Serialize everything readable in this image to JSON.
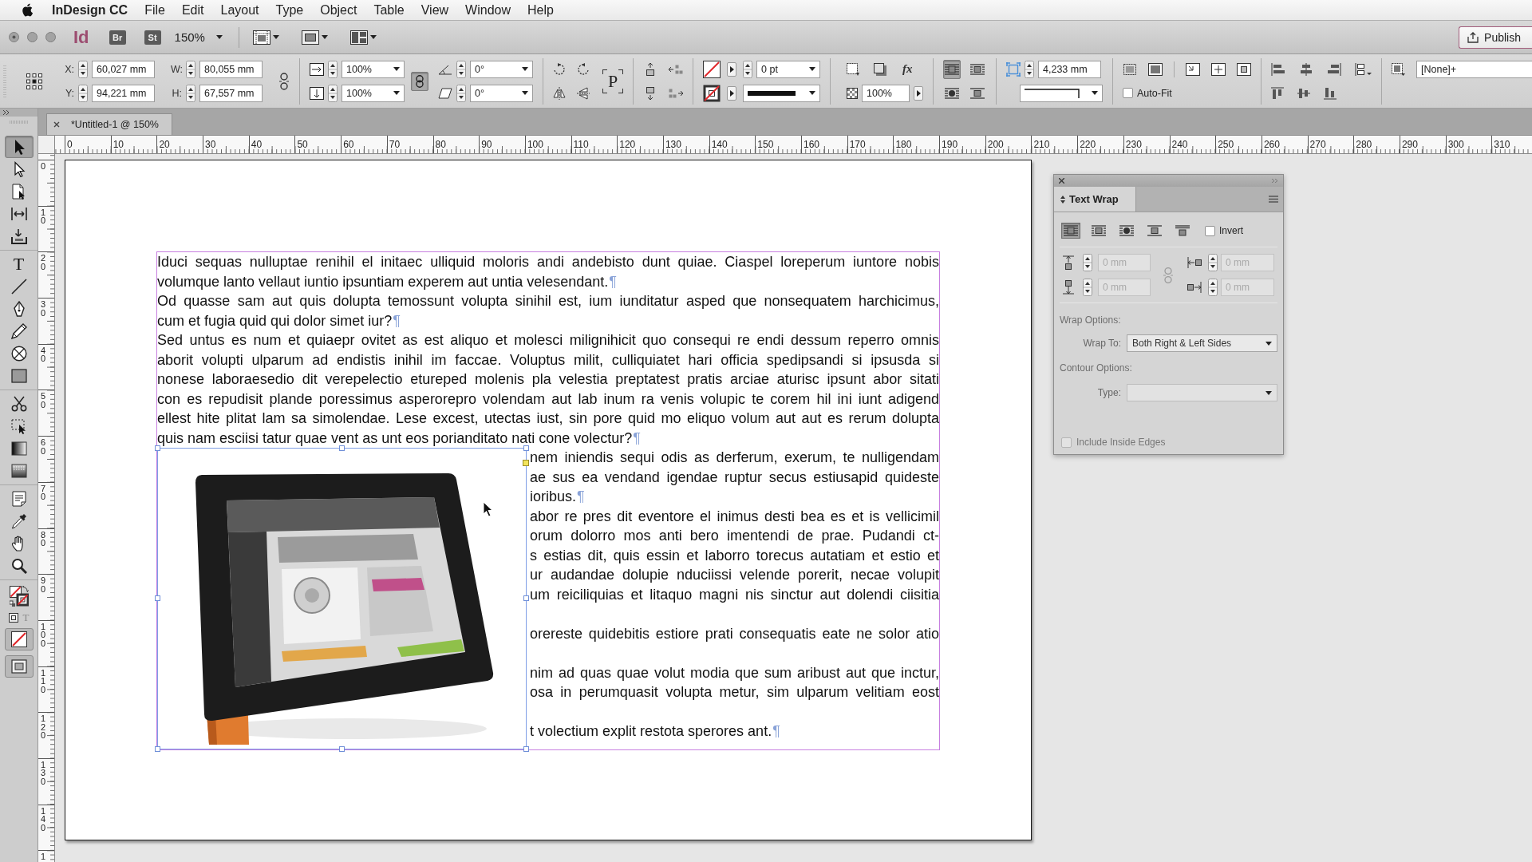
{
  "menu_bar": {
    "app_name": "InDesign CC",
    "menus": [
      "File",
      "Edit",
      "Layout",
      "Type",
      "Object",
      "Table",
      "View",
      "Window",
      "Help"
    ]
  },
  "app_bar": {
    "logo": "Id",
    "bridge_button": "Br",
    "stock_button": "St",
    "zoom_level": "150%",
    "publish_button": "Publish"
  },
  "control_panel": {
    "position": [
      {
        "label": "X:",
        "value": "60,027 mm"
      },
      {
        "label": "Y:",
        "value": "94,221 mm"
      }
    ],
    "size": [
      {
        "label": "W:",
        "value": "80,055 mm"
      },
      {
        "label": "H:",
        "value": "67,557 mm"
      }
    ],
    "scale": [
      "100%",
      "100%"
    ],
    "scale_linked": true,
    "angles": [
      "0°",
      "0°"
    ],
    "direction_indicator": "P",
    "stroke_weight": "0 pt",
    "effects": "fx",
    "opacity": "100%",
    "wrap_buttons": [
      {
        "kind": "none",
        "selected": true
      },
      {
        "kind": "bounding_box",
        "selected": false
      },
      {
        "kind": "object_shape",
        "selected": false
      },
      {
        "kind": "jump_object",
        "selected": false
      }
    ],
    "fitting_offset": "4,233 mm",
    "auto_fit": {
      "label": "Auto-Fit",
      "checked": false
    },
    "object_style": "[None]+"
  },
  "toolbox": {
    "groups": [
      [
        {
          "kind": "selection",
          "selected": true
        },
        {
          "kind": "direct_selection",
          "selected": false
        },
        {
          "kind": "page",
          "selected": false
        },
        {
          "kind": "gap",
          "selected": false
        },
        {
          "kind": "content_collector",
          "selected": false
        }
      ],
      [
        {
          "kind": "type",
          "glyph": "T",
          "selected": false
        },
        {
          "kind": "line",
          "selected": false
        },
        {
          "kind": "pen",
          "selected": false
        },
        {
          "kind": "pencil",
          "selected": false
        },
        {
          "kind": "ellipse_frame",
          "selected": false
        },
        {
          "kind": "rectangle",
          "selected": false
        }
      ],
      [
        {
          "kind": "scissors",
          "selected": false
        },
        {
          "kind": "free_transform",
          "selected": false
        },
        {
          "kind": "gradient_swatch",
          "selected": false
        },
        {
          "kind": "gradient_feather",
          "selected": false
        }
      ],
      [
        {
          "kind": "note",
          "selected": false
        },
        {
          "kind": "eyedropper",
          "selected": false
        },
        {
          "kind": "hand",
          "selected": false
        },
        {
          "kind": "zoom",
          "selected": false
        }
      ],
      [
        {
          "kind": "fill_stroke"
        },
        {
          "kind": "formatting",
          "glyph": "T"
        },
        {
          "kind": "apply_none"
        },
        {
          "kind": "screen_mode"
        }
      ]
    ]
  },
  "document_tabs": [
    {
      "title": "*Untitled-1 @ 150%",
      "selected": true
    }
  ],
  "rulers": {
    "horizontal": [
      "0",
      "10",
      "20",
      "30",
      "40",
      "50",
      "60",
      "70",
      "80",
      "90",
      "100",
      "110",
      "120",
      "130",
      "140",
      "150",
      "160",
      "170",
      "180",
      "190",
      "200",
      "210",
      "220",
      "230",
      "240",
      "250",
      "260",
      "270",
      "280",
      "290",
      "300",
      "310"
    ],
    "vertical": [
      "0",
      "10",
      "20",
      "30",
      "40",
      "50",
      "60",
      "70",
      "80",
      "90",
      "100",
      "110",
      "120",
      "130",
      "140",
      "1"
    ]
  },
  "text_frame": {
    "lines": [
      {
        "kind": "line",
        "text": "Iduci sequas nulluptae renihil el initaec ulliquid moloris andi andebisto dunt quiae. Ciaspel loreperum iuntore nobis"
      },
      {
        "kind": "end",
        "text": "volumque lanto vellaut iuntio ipsuntiam experem aut untia velesendant.",
        "pilcrow": "¶"
      },
      {
        "kind": "line",
        "text": "Od quasse sam aut quis dolupta temossunt volupta sinihil est, ium iunditatur asped que nonsequatem harchicimus,"
      },
      {
        "kind": "end",
        "text": "cum et fugia quid qui dolor simet iur?",
        "pilcrow": "¶"
      },
      {
        "kind": "line",
        "text": "Sed untus es num et quiaepr ovitet as est aliquo et molesci milignihicit quo consequi re endi dessum reperro omnis"
      },
      {
        "kind": "line",
        "text": "aborit volupti ulparum ad endistis inihil im faccae. Voluptus milit, culliquiatet hari officia spedipsandi si ipsusda si"
      },
      {
        "kind": "line",
        "text": "nonese laboraesedio dit verepelectio etureped molenis pla velestia preptatest pratis arciae aturisc ipsunt abor sitati"
      },
      {
        "kind": "line",
        "text": "con es repudisit plande poressimus asperorepro volendam aut lab inum ra venis volupic te corem hil ini iunt adigend"
      },
      {
        "kind": "line",
        "text": "ellest hite plitat lam sa simolendae. Lese excest, utectas iust, sin pore quid mo eliquo volum aut aut es rerum dolupta"
      },
      {
        "kind": "end",
        "text": "quis nam esciisi tatur quae vent as unt eos porianditato nati cone volectur?",
        "pilcrow": "¶"
      }
    ],
    "wrapped_lines": [
      {
        "kind": "line",
        "text": "nem iniendis sequi odis as derferum, exerum, te nulligendam"
      },
      {
        "kind": "line",
        "text": "ae sus ea vendand igendae ruptur secus estiusapid quideste"
      },
      {
        "kind": "end",
        "text": "ioribus.",
        "pilcrow": "¶"
      },
      {
        "kind": "line",
        "text": "abor re pres dit eventore el inimus desti bea es et is vellicimil"
      },
      {
        "kind": "line",
        "text": "orum dolorro mos anti bero imentendi de prae. Pudandi ct-"
      },
      {
        "kind": "line",
        "text": "s estias dit, quis essin et laborro torecus autatiam et estio et"
      },
      {
        "kind": "line",
        "text": "ur audandae dolupie nduciissi velende porerit, necae volupit"
      },
      {
        "kind": "line",
        "text": "um reiciliquias et litaquo magni nis sinctur aut dolendi ciisitia"
      },
      {
        "kind": "blank"
      },
      {
        "kind": "line",
        "text": "orereste quidebitis estiore prati consequatis eate ne solor atio"
      },
      {
        "kind": "blank"
      },
      {
        "kind": "line",
        "text": "nim ad quas quae volut modia que sum aribust aut que inctur,"
      },
      {
        "kind": "line",
        "text": "osa in perumquasit volupta metur, sim ulparum velitiam eost"
      },
      {
        "kind": "blank"
      },
      {
        "kind": "end",
        "text": "t volectium explit restota sperores ant.",
        "pilcrow": "¶"
      }
    ]
  },
  "image_frame": {
    "selected": true
  },
  "text_wrap_panel": {
    "tab": "Text Wrap",
    "wrap_modes": [
      {
        "kind": "none",
        "selected": true
      },
      {
        "kind": "bounding_box",
        "selected": false
      },
      {
        "kind": "object_shape",
        "selected": false
      },
      {
        "kind": "jump_object",
        "selected": false
      },
      {
        "kind": "next_column",
        "selected": false
      }
    ],
    "invert": {
      "label": "Invert",
      "checked": false
    },
    "offsets": [
      {
        "kind": "top",
        "value": "0 mm",
        "disabled": true
      },
      {
        "kind": "bottom",
        "value": "0 mm",
        "disabled": true
      },
      {
        "kind": "left",
        "value": "0 mm",
        "disabled": true
      },
      {
        "kind": "right",
        "value": "0 mm",
        "disabled": true
      }
    ],
    "wrap_options_heading": "Wrap Options:",
    "wrap_to": {
      "label": "Wrap To:",
      "value": "Both Right & Left Sides"
    },
    "contour_options_heading": "Contour Options:",
    "contour_type": {
      "label": "Type:",
      "disabled": true
    },
    "include_inside_edges": {
      "label": "Include Inside Edges",
      "checked": false,
      "disabled": true
    }
  }
}
